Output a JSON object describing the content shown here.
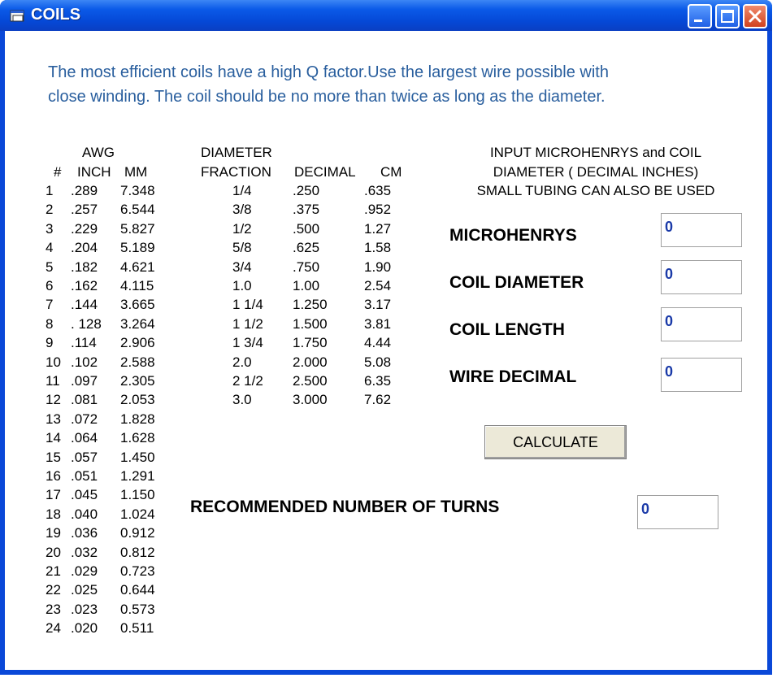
{
  "window": {
    "title": "COILS"
  },
  "intro": {
    "line1": "The most efficient coils have a high Q factor.Use the largest wire possible with",
    "line2": "close winding. The coil should be no more than  twice as long as the diameter."
  },
  "awg": {
    "title": "AWG",
    "headers": [
      "#",
      "INCH",
      "MM"
    ],
    "rows": [
      [
        "1",
        ".289",
        "7.348"
      ],
      [
        "2",
        ".257",
        "6.544"
      ],
      [
        "3",
        ".229",
        "5.827"
      ],
      [
        "4",
        ".204",
        "5.189"
      ],
      [
        "5",
        ".182",
        "4.621"
      ],
      [
        "6",
        ".162",
        "4.115"
      ],
      [
        "7",
        ".144",
        "3.665"
      ],
      [
        "8",
        ". 128",
        "3.264"
      ],
      [
        "9",
        ".114",
        "2.906"
      ],
      [
        "10",
        ".102",
        "2.588"
      ],
      [
        "11",
        ".097",
        "2.305"
      ],
      [
        "12",
        ".081",
        "2.053"
      ],
      [
        "13",
        ".072",
        "1.828"
      ],
      [
        "14",
        ".064",
        "1.628"
      ],
      [
        "15",
        ".057",
        "1.450"
      ],
      [
        "16",
        ".051",
        "1.291"
      ],
      [
        "17",
        ".045",
        "1.150"
      ],
      [
        "18",
        ".040",
        "1.024"
      ],
      [
        "19",
        ".036",
        "0.912"
      ],
      [
        "20",
        ".032",
        "0.812"
      ],
      [
        "21",
        ".029",
        "0.723"
      ],
      [
        "22",
        ".025",
        "0.644"
      ],
      [
        "23",
        ".023",
        "0.573"
      ],
      [
        "24",
        ".020",
        "0.511"
      ]
    ]
  },
  "diameter": {
    "title": "DIAMETER",
    "headers": [
      "FRACTION",
      "DECIMAL",
      "CM"
    ],
    "rows": [
      [
        "1/4",
        ".250",
        ".635"
      ],
      [
        "3/8",
        ".375",
        ".952"
      ],
      [
        "1/2",
        ".500",
        "1.27"
      ],
      [
        "5/8",
        ".625",
        "1.58"
      ],
      [
        "3/4",
        ".750",
        "1.90"
      ],
      [
        "1.0",
        "1.00",
        "2.54"
      ],
      [
        "1 1/4",
        "1.250",
        "3.17"
      ],
      [
        "1 1/2",
        "1.500",
        "3.81"
      ],
      [
        "1 3/4",
        "1.750",
        "4.44"
      ],
      [
        "2.0",
        "2.000",
        "5.08"
      ],
      [
        "2 1/2",
        "2.500",
        "6.35"
      ],
      [
        "3.0",
        "3.000",
        "7.62"
      ]
    ]
  },
  "instructions": {
    "line1": "INPUT MICROHENRYS and COIL",
    "line2": "DIAMETER ( DECIMAL INCHES)",
    "line3": "SMALL TUBING CAN ALSO BE USED"
  },
  "fields": {
    "microhenrys": {
      "label": "MICROHENRYS",
      "value": "0"
    },
    "coil_diameter": {
      "label": "COIL DIAMETER",
      "value": "0"
    },
    "coil_length": {
      "label": "COIL LENGTH",
      "value": "0"
    },
    "wire_decimal": {
      "label": "WIRE DECIMAL",
      "value": "0"
    }
  },
  "calculate_label": "CALCULATE",
  "result": {
    "label": "RECOMMENDED  NUMBER OF TURNS",
    "value": "0"
  },
  "colors": {
    "titlebar": "#0548d6",
    "intro_text": "#2a5f9e",
    "input_text": "#1a3aa8"
  },
  "icons": {
    "title": "window-icon",
    "minimize": "minimize-icon",
    "maximize": "maximize-icon",
    "close": "close-icon"
  }
}
